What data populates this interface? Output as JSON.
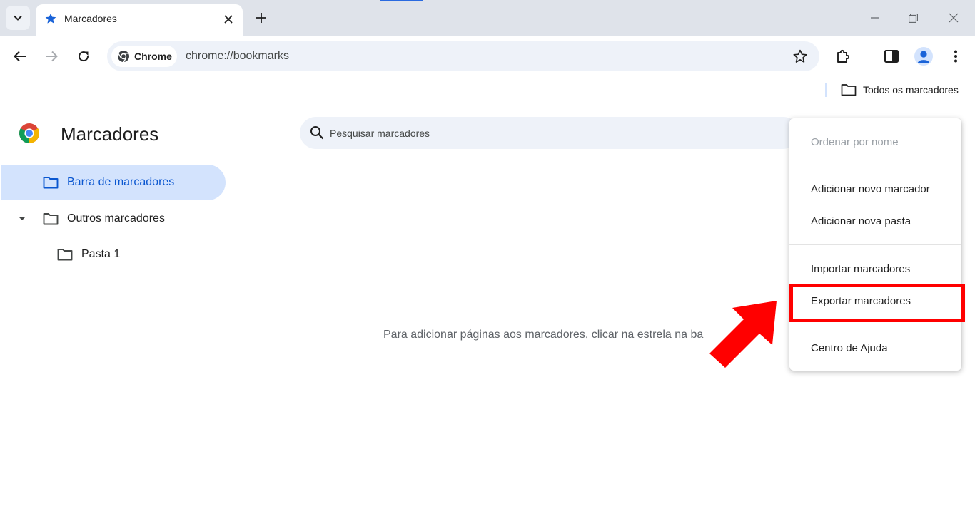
{
  "tab": {
    "title": "Marcadores"
  },
  "omnibox": {
    "chip_label": "Chrome",
    "url": "chrome://bookmarks"
  },
  "bookmarks_bar": {
    "all_bookmarks": "Todos os marcadores"
  },
  "page": {
    "title": "Marcadores",
    "search_placeholder": "Pesquisar marcadores",
    "empty_message": "Para adicionar páginas aos marcadores, clicar na estrela na ba"
  },
  "tree": [
    {
      "label": "Barra de marcadores",
      "selected": true
    },
    {
      "label": "Outros marcadores",
      "expanded": true
    },
    {
      "label": "Pasta 1"
    }
  ],
  "menu": {
    "items": [
      {
        "label": "Ordenar por nome",
        "disabled": true
      },
      {
        "label": "Adicionar novo marcador"
      },
      {
        "label": "Adicionar nova pasta"
      },
      {
        "label": "Importar marcadores"
      },
      {
        "label": "Exportar marcadores",
        "highlighted": true
      },
      {
        "label": "Centro de Ajuda"
      }
    ]
  },
  "colors": {
    "accent": "#0b57d0",
    "highlight": "#ff0000",
    "selected_bg": "#d3e3fd"
  }
}
